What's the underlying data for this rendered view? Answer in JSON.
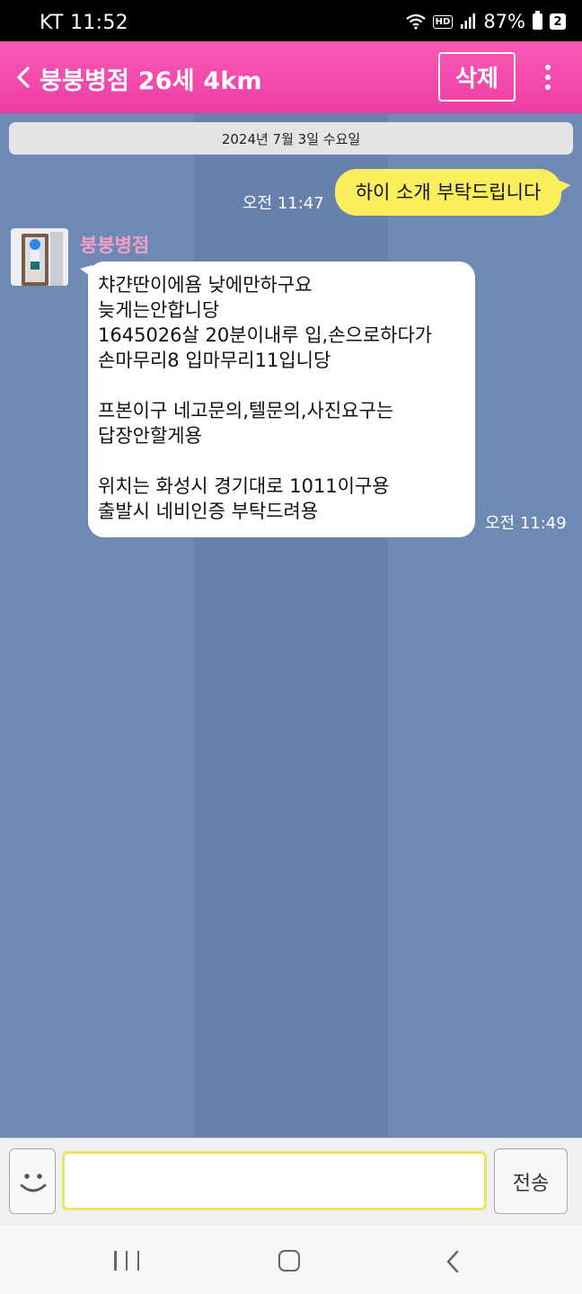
{
  "status_bar": {
    "carrier": "KT",
    "time": "11:52",
    "hd_label": "HD",
    "battery": "87%",
    "notification_count": "2"
  },
  "header": {
    "title": "붕붕병점 26세 4km",
    "delete_label": "삭제",
    "background_color": "#f04aaa"
  },
  "chat": {
    "date_divider": "2024년 7월 3일 수요일",
    "messages": [
      {
        "direction": "sent",
        "text": "하이 소개 부탁드립니다",
        "time": "오전 11:47"
      },
      {
        "direction": "received",
        "sender": "붕붕병점",
        "lines": [
          "챠갼딴이에욤 낮에만하구요",
          "늦게는안합니당",
          "1645026살 20분이내루 입,손으로하다가",
          "손마무리8 입마무리11입니당",
          "",
          "프본이구 네고문의,텔문의,사진요구는",
          "답장안할게용",
          "",
          "위치는 화성시 경기대로 1011이구용",
          "출발시 네비인증 부탁드려용"
        ],
        "time": "오전 11:49"
      }
    ]
  },
  "input_bar": {
    "placeholder": "",
    "send_label": "전송"
  },
  "colors": {
    "sent_bubble": "#fbee5c",
    "received_bubble": "#ffffff",
    "chat_background": "#6e89b4",
    "sender_name": "#f3a0c8"
  }
}
